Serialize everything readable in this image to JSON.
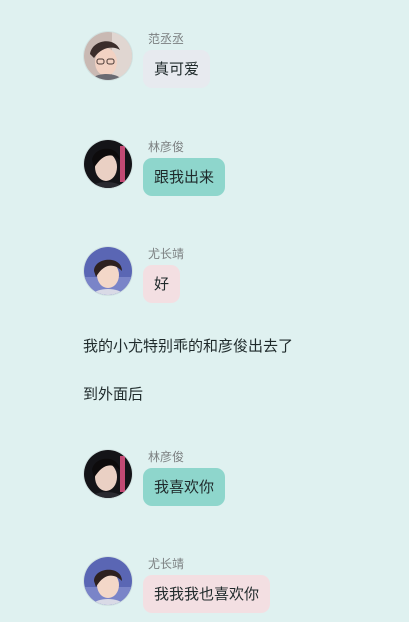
{
  "messages": [
    {
      "sender": "范丞丞",
      "text": "真可爱",
      "bubble_color": "#e7eaef",
      "avatar": "avatar-portrait-fan"
    },
    {
      "sender": "林彦俊",
      "text": "跟我出来",
      "bubble_color": "#8ed6cc",
      "avatar": "avatar-portrait-lin"
    },
    {
      "sender": "尤长靖",
      "text": "好",
      "bubble_color": "#f3dfe2",
      "avatar": "avatar-portrait-you"
    },
    {
      "sender": "林彦俊",
      "text": "我喜欢你",
      "bubble_color": "#8ed6cc",
      "avatar": "avatar-portrait-lin"
    },
    {
      "sender": "尤长靖",
      "text": "我我我也喜欢你",
      "bubble_color": "#f3dfe2",
      "avatar": "avatar-portrait-you"
    }
  ],
  "narration": [
    "我的小尤特别乖的和彦俊出去了",
    "到外面后"
  ],
  "colors": {
    "background": "#dff1f0",
    "sender_text": "#7b7f80",
    "body_text": "#1f2a2b"
  }
}
